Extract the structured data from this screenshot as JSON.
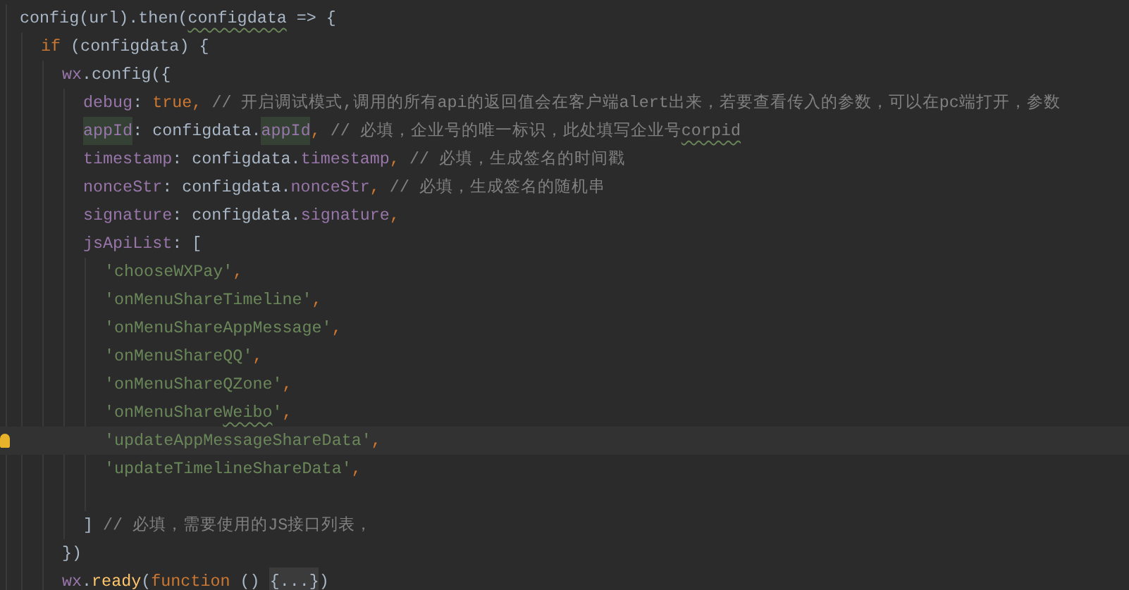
{
  "editor": {
    "lines": [
      {
        "current": false,
        "tokens": [
          {
            "kind": "plain",
            "text": "config(url).then("
          },
          {
            "kind": "plain",
            "text": "configdata",
            "typo": true
          },
          {
            "kind": "plain",
            "text": " => {"
          }
        ],
        "children": [
          {
            "current": false,
            "tokens": [
              {
                "kind": "keyword",
                "text": "if"
              },
              {
                "kind": "plain",
                "text": " (configdata) {"
              }
            ],
            "children": [
              {
                "current": false,
                "tokens": [
                  {
                    "kind": "prop",
                    "text": "wx"
                  },
                  {
                    "kind": "plain",
                    "text": ".config({"
                  }
                ],
                "children": [
                  {
                    "current": false,
                    "tokens": [
                      {
                        "kind": "prop",
                        "text": "debug"
                      },
                      {
                        "kind": "plain",
                        "text": ": "
                      },
                      {
                        "kind": "keyword",
                        "text": "true,"
                      },
                      {
                        "kind": "comment",
                        "text": " // 开启调试模式,调用的所有api的返回值会在客户端alert出来，若要查看传入的参数，可以在pc端打开，参数"
                      }
                    ]
                  },
                  {
                    "current": false,
                    "tokens": [
                      {
                        "kind": "prop",
                        "text": "appId",
                        "highlighted": true
                      },
                      {
                        "kind": "plain",
                        "text": ": configdata."
                      },
                      {
                        "kind": "prop",
                        "text": "appId",
                        "highlighted": true
                      },
                      {
                        "kind": "punct",
                        "text": ","
                      },
                      {
                        "kind": "comment",
                        "text": " // 必填，企业号的唯一标识，此处填写企业号"
                      },
                      {
                        "kind": "comment",
                        "text": "corpid",
                        "typo": true
                      }
                    ]
                  },
                  {
                    "current": false,
                    "tokens": [
                      {
                        "kind": "prop",
                        "text": "timestamp"
                      },
                      {
                        "kind": "plain",
                        "text": ": configdata."
                      },
                      {
                        "kind": "prop",
                        "text": "timestamp"
                      },
                      {
                        "kind": "punct",
                        "text": ","
                      },
                      {
                        "kind": "comment",
                        "text": " // 必填，生成签名的时间戳"
                      }
                    ]
                  },
                  {
                    "current": false,
                    "tokens": [
                      {
                        "kind": "prop",
                        "text": "nonceStr"
                      },
                      {
                        "kind": "plain",
                        "text": ": configdata."
                      },
                      {
                        "kind": "prop",
                        "text": "nonceStr"
                      },
                      {
                        "kind": "punct",
                        "text": ","
                      },
                      {
                        "kind": "comment",
                        "text": " // 必填，生成签名的随机串"
                      }
                    ]
                  },
                  {
                    "current": false,
                    "tokens": [
                      {
                        "kind": "prop",
                        "text": "signature"
                      },
                      {
                        "kind": "plain",
                        "text": ": configdata."
                      },
                      {
                        "kind": "prop",
                        "text": "signature"
                      },
                      {
                        "kind": "punct",
                        "text": ","
                      }
                    ]
                  },
                  {
                    "current": false,
                    "tokens": [
                      {
                        "kind": "prop",
                        "text": "jsApiList"
                      },
                      {
                        "kind": "plain",
                        "text": ": ["
                      }
                    ],
                    "children": [
                      {
                        "current": false,
                        "tokens": [
                          {
                            "kind": "string",
                            "text": "'chooseWXPay'"
                          },
                          {
                            "kind": "punct",
                            "text": ","
                          }
                        ]
                      },
                      {
                        "current": false,
                        "tokens": [
                          {
                            "kind": "string",
                            "text": "'onMenuShareTimeline'"
                          },
                          {
                            "kind": "punct",
                            "text": ","
                          }
                        ]
                      },
                      {
                        "current": false,
                        "tokens": [
                          {
                            "kind": "string",
                            "text": "'onMenuShareAppMessage'"
                          },
                          {
                            "kind": "punct",
                            "text": ","
                          }
                        ]
                      },
                      {
                        "current": false,
                        "tokens": [
                          {
                            "kind": "string",
                            "text": "'onMenuShareQQ'"
                          },
                          {
                            "kind": "punct",
                            "text": ","
                          }
                        ]
                      },
                      {
                        "current": false,
                        "tokens": [
                          {
                            "kind": "string",
                            "text": "'onMenuShareQZone'"
                          },
                          {
                            "kind": "punct",
                            "text": ","
                          }
                        ]
                      },
                      {
                        "current": false,
                        "tokens": [
                          {
                            "kind": "string",
                            "text": "'onMenuShare"
                          },
                          {
                            "kind": "string",
                            "text": "Weibo",
                            "typo": true
                          },
                          {
                            "kind": "string",
                            "text": "'"
                          },
                          {
                            "kind": "punct",
                            "text": ","
                          }
                        ]
                      },
                      {
                        "current": true,
                        "tokens": [
                          {
                            "kind": "string",
                            "text": "'updateAppMessageShareData'"
                          },
                          {
                            "kind": "punct",
                            "text": ","
                          }
                        ]
                      },
                      {
                        "current": false,
                        "tokens": [
                          {
                            "kind": "string",
                            "text": "'updateTimelineShareData'"
                          },
                          {
                            "kind": "punct",
                            "text": ","
                          }
                        ]
                      },
                      {
                        "current": false
                      }
                    ]
                  },
                  {
                    "current": false,
                    "tokens": [
                      {
                        "kind": "plain",
                        "text": "]"
                      },
                      {
                        "kind": "comment",
                        "text": " // 必填，需要使用的JS接口列表，"
                      }
                    ]
                  }
                ]
              },
              {
                "current": false,
                "tokens": [
                  {
                    "kind": "plain",
                    "text": "})"
                  }
                ]
              },
              {
                "current": false,
                "tokens": [
                  {
                    "kind": "prop",
                    "text": "wx"
                  },
                  {
                    "kind": "plain",
                    "text": "."
                  },
                  {
                    "kind": "fn",
                    "text": "ready"
                  },
                  {
                    "kind": "plain",
                    "text": "("
                  },
                  {
                    "kind": "keyword",
                    "text": "function"
                  },
                  {
                    "kind": "plain",
                    "text": " () "
                  },
                  {
                    "kind": "fold",
                    "text": "{...}"
                  },
                  {
                    "kind": "plain",
                    "text": ")"
                  }
                ]
              }
            ]
          }
        ]
      }
    ]
  }
}
